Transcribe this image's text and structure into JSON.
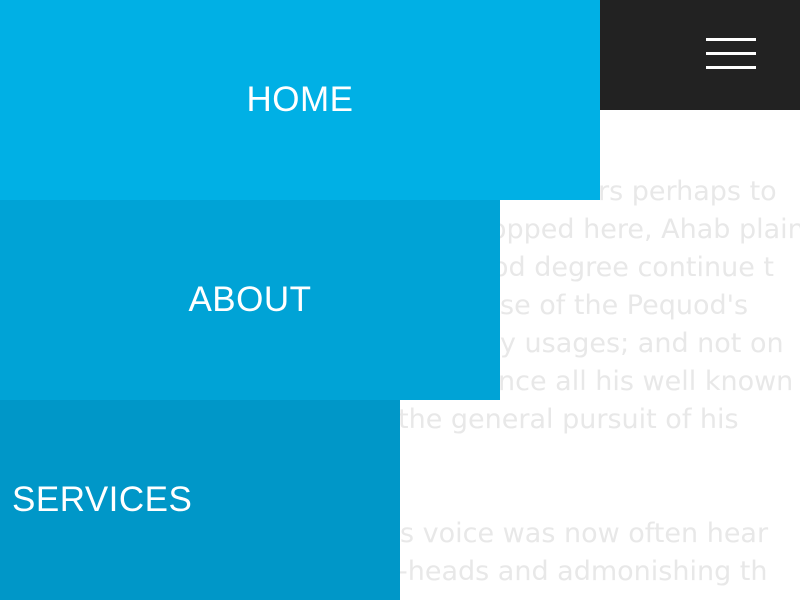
{
  "background_text": {
    "lines": [
      "rs perhaps to",
      "opped here, Ahab plain",
      "od degree continue t",
      "se of the Pequod's",
      "y usages; and not on",
      "nce all his well known",
      "the general pursuit of his",
      "s voice was now often hear",
      "-heads and admonishing th"
    ]
  },
  "menu": {
    "icon": "hamburger-icon",
    "items": [
      {
        "label": "HOME",
        "color": "#00b0e5"
      },
      {
        "label": "ABOUT",
        "color": "#00a3d6"
      },
      {
        "label": "SERVICES",
        "color": "#0097c8"
      }
    ]
  },
  "colors": {
    "topbar": "#222222",
    "background_text": "#e8e8e8"
  }
}
